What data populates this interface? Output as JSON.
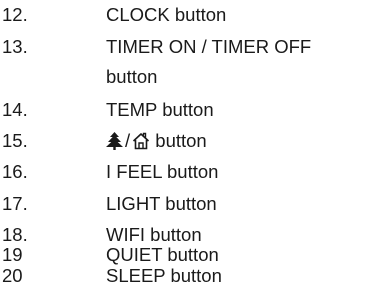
{
  "items": [
    {
      "number": "12.",
      "text": "CLOCK button"
    },
    {
      "number": "13.",
      "text": "TIMER ON / TIMER OFF",
      "text_cont": "button"
    },
    {
      "number": "14.",
      "text": "TEMP button"
    },
    {
      "number": "15.",
      "icon_left": "tree-icon",
      "separator": "/",
      "icon_right": "house-icon",
      "text": "button"
    },
    {
      "number": "16.",
      "text": "I FEEL button"
    },
    {
      "number": "17.",
      "text": "LIGHT button"
    },
    {
      "number": "18.",
      "text": "WIFI button"
    },
    {
      "number": "19",
      "text": "QUIET button"
    },
    {
      "number": "20",
      "text": "SLEEP button"
    }
  ]
}
